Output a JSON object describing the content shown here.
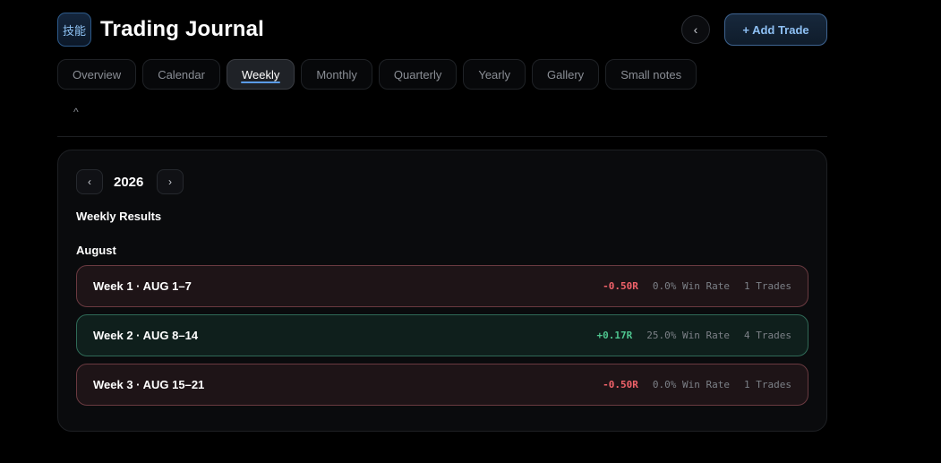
{
  "header": {
    "logo_text": "技能",
    "title": "Trading Journal",
    "collapse_glyph": "‹",
    "add_trade_label": "+ Add Trade"
  },
  "tabs": [
    {
      "label": "Overview",
      "active": false
    },
    {
      "label": "Calendar",
      "active": false
    },
    {
      "label": "Weekly",
      "active": true
    },
    {
      "label": "Monthly",
      "active": false
    },
    {
      "label": "Quarterly",
      "active": false
    },
    {
      "label": "Yearly",
      "active": false
    },
    {
      "label": "Gallery",
      "active": false
    },
    {
      "label": "Small notes",
      "active": false
    }
  ],
  "caret_glyph": "^",
  "panel": {
    "prev_glyph": "‹",
    "next_glyph": "›",
    "year": "2026",
    "section_title": "Weekly Results",
    "month": "August",
    "weeks": [
      {
        "label": "Week 1 · AUG 1–7",
        "r": "-0.50R",
        "win_rate": "0.0% Win Rate",
        "trades": "1 Trades",
        "result": "loss"
      },
      {
        "label": "Week 2 · AUG 8–14",
        "r": "+0.17R",
        "win_rate": "25.0% Win Rate",
        "trades": "4 Trades",
        "result": "win"
      },
      {
        "label": "Week 3 · AUG 15–21",
        "r": "-0.50R",
        "win_rate": "0.0% Win Rate",
        "trades": "1 Trades",
        "result": "loss"
      }
    ]
  },
  "colors": {
    "accent": "#5a9be6",
    "loss": "#f0626a",
    "win": "#4ec58f"
  }
}
